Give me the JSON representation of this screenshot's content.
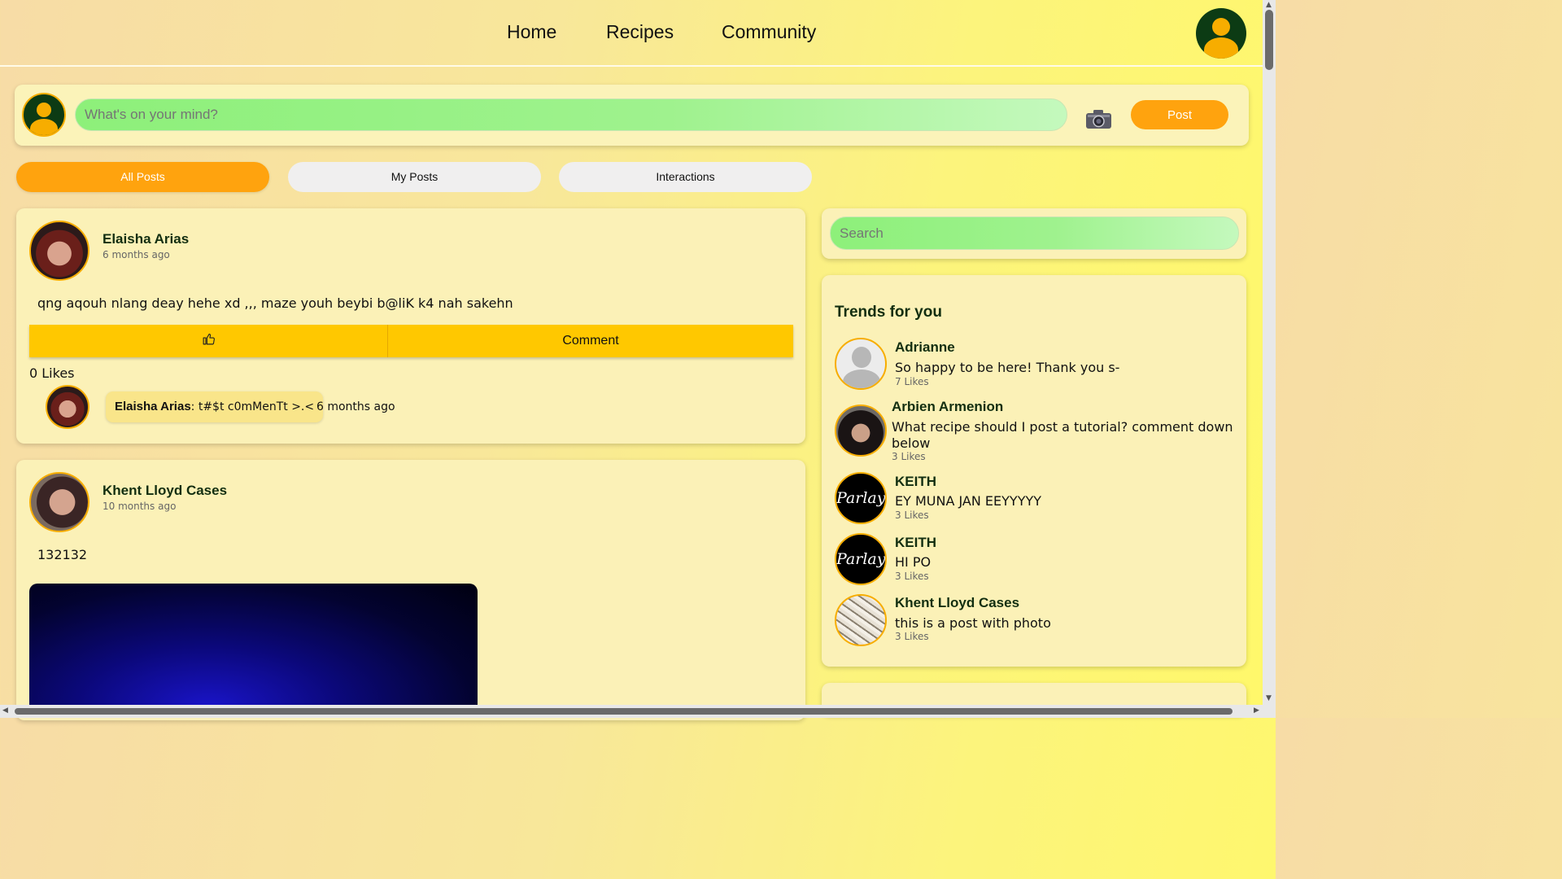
{
  "nav": {
    "links": [
      "Home",
      "Recipes",
      "Community"
    ],
    "profile_icon": "user-avatar-icon"
  },
  "composer": {
    "placeholder": "What's on your mind?",
    "camera_icon": "camera-icon",
    "post_label": "Post"
  },
  "tabs": [
    {
      "label": "All Posts",
      "active": true
    },
    {
      "label": "My Posts",
      "active": false
    },
    {
      "label": "Interactions",
      "active": false
    }
  ],
  "posts": [
    {
      "author": "Elaisha Arias",
      "time": "6 months ago",
      "text": "qng aqouh nlang deay hehe xd ,,, maze youh beybi b@liK k4 nah sakehn",
      "like_icon": "thumbs-up-icon",
      "comment_label": "Comment",
      "likes": "0 Likes",
      "comments": [
        {
          "author": "Elaisha Arias",
          "text": ": t#$t c0mMenTt >.<",
          "time": "6 months ago"
        }
      ]
    },
    {
      "author": "Khent Lloyd Cases",
      "time": "10 months ago",
      "text": "132132"
    }
  ],
  "sidebar": {
    "search_placeholder": "Search",
    "trends_title": "Trends for you",
    "trends": [
      {
        "name": "Adrianne",
        "text": "So happy to be here! Thank you s-",
        "likes": "7 Likes"
      },
      {
        "name": "Arbien Armenion",
        "text": "What recipe should I post a tutorial? comment down below",
        "likes": "3 Likes"
      },
      {
        "name": "KEITH",
        "text": "EY MUNA JAN EEYYYYY",
        "likes": "3 Likes",
        "avatar_logo": "Parlay"
      },
      {
        "name": "KEITH",
        "text": "HI PO",
        "likes": "3 Likes",
        "avatar_logo": "Parlay"
      },
      {
        "name": "Khent Lloyd Cases",
        "text": "this is a post with photo",
        "likes": "3 Likes"
      }
    ]
  },
  "colors": {
    "accent_orange": "#ffa30e",
    "action_yellow": "#ffc800",
    "card_bg": "#fbf1b7",
    "input_green": "#8df07a",
    "avatar_dark_green": "#0c3b14"
  }
}
